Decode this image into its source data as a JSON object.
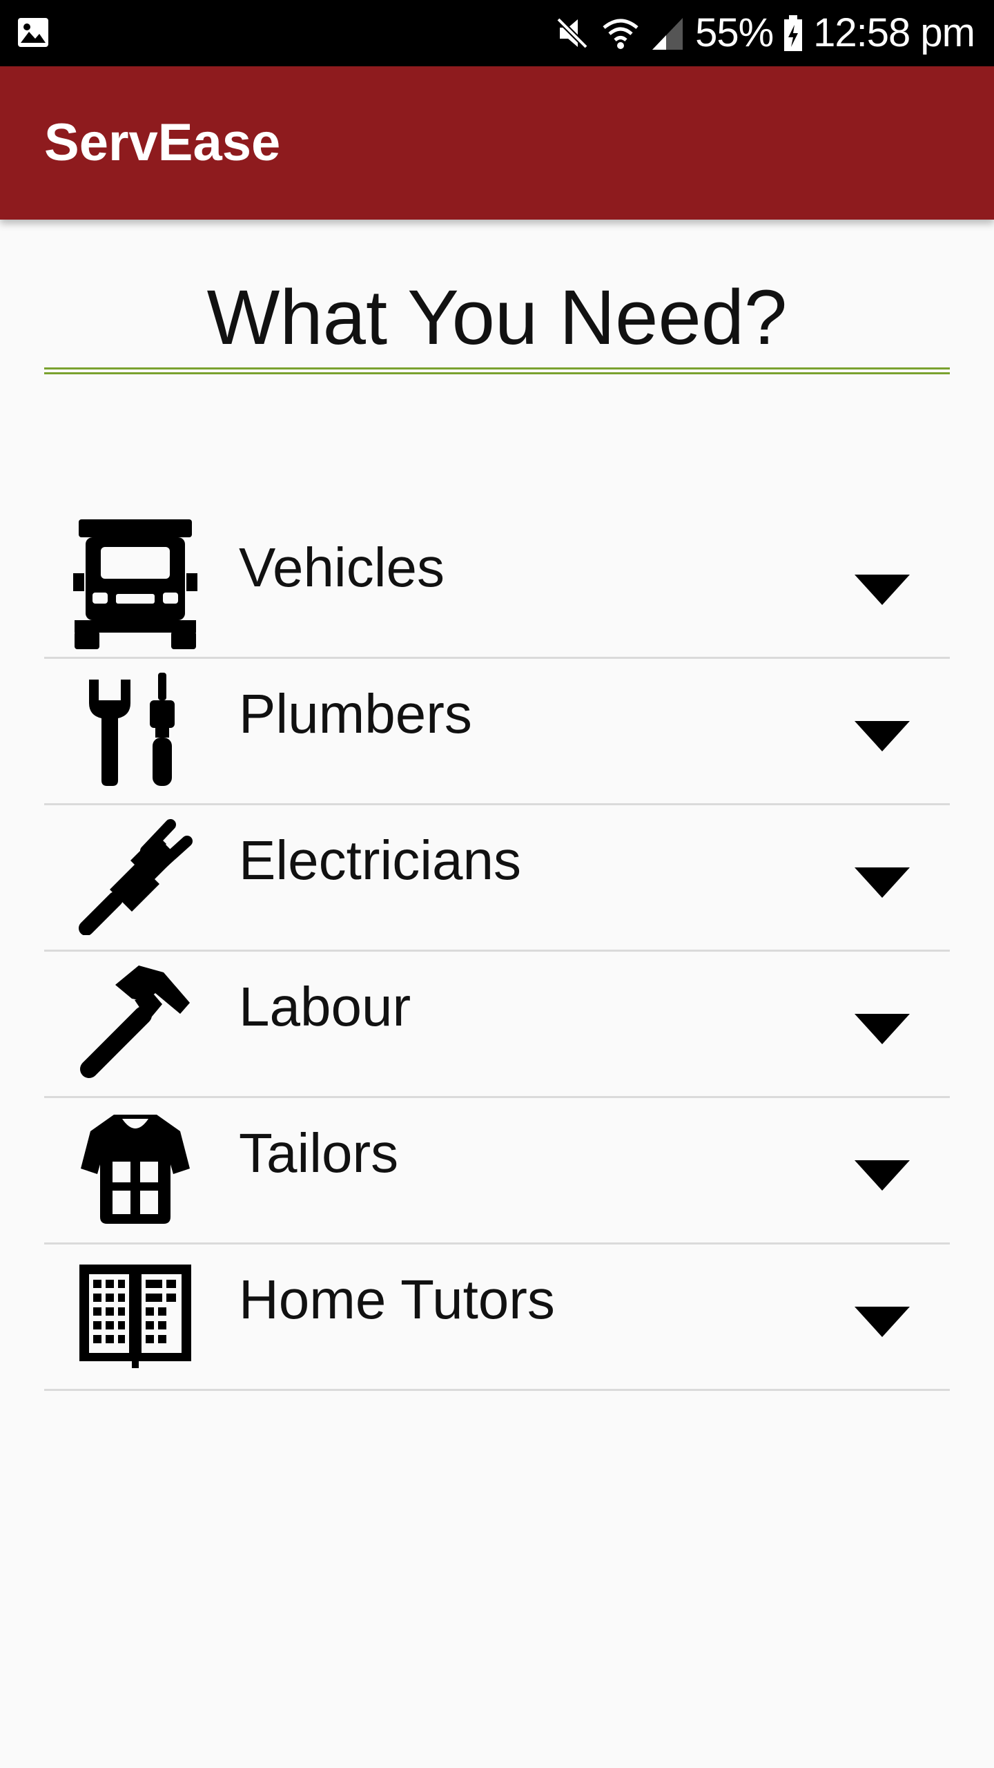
{
  "status_bar": {
    "battery": "55%",
    "time": "12:58 pm",
    "icons": [
      "gallery-icon",
      "mute-icon",
      "wifi-icon",
      "signal-icon",
      "battery-charging-icon"
    ]
  },
  "app_bar": {
    "title": "ServEase"
  },
  "page": {
    "heading": "What You Need?"
  },
  "categories": [
    {
      "label": "Vehicles",
      "icon": "truck-icon"
    },
    {
      "label": "Plumbers",
      "icon": "tools-icon"
    },
    {
      "label": "Electricians",
      "icon": "plug-icon"
    },
    {
      "label": "Labour",
      "icon": "hammer-icon"
    },
    {
      "label": "Tailors",
      "icon": "shirt-icon"
    },
    {
      "label": "Home Tutors",
      "icon": "book-icon"
    }
  ],
  "colors": {
    "app_bar": "#8e1b1e",
    "divider_accent": "#7aa22f",
    "background": "#fafafa"
  }
}
